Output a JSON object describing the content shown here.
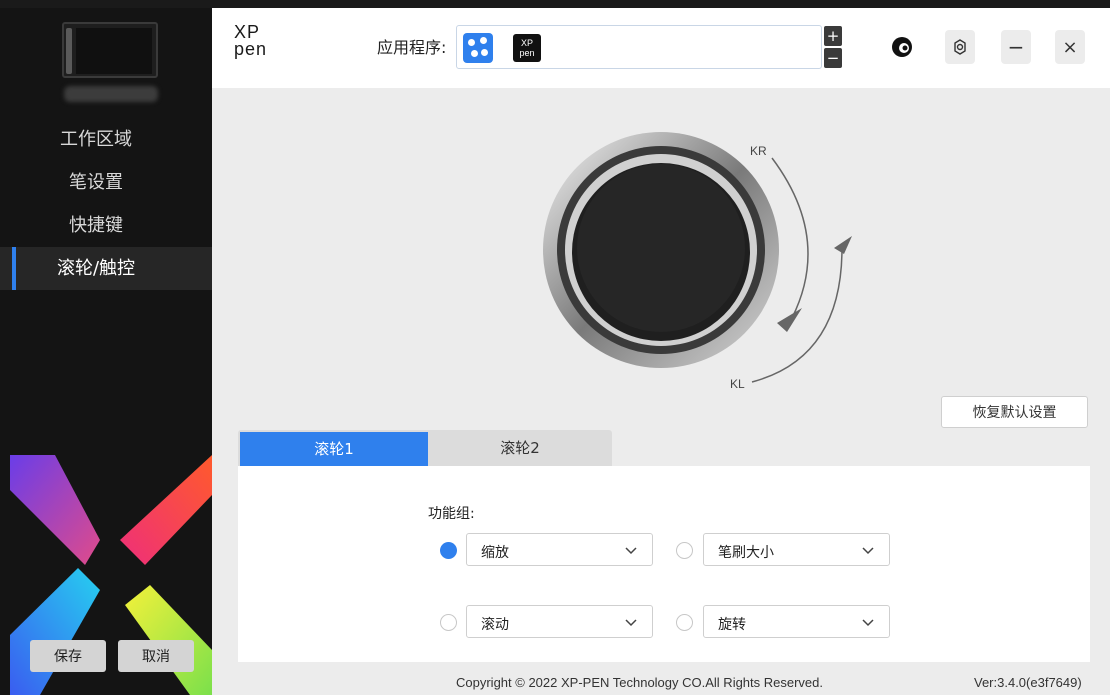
{
  "sidebar": {
    "nav_items": [
      {
        "label": "工作区域"
      },
      {
        "label": "笔设置"
      },
      {
        "label": "快捷键"
      },
      {
        "label": "滚轮/触控"
      }
    ],
    "active_index": 3,
    "save_label": "保存",
    "cancel_label": "取消"
  },
  "header": {
    "logo_line1": "XP",
    "logo_line2": "pen",
    "app_label": "应用程序:",
    "apps": [
      {
        "icon": "all-apps-icon"
      },
      {
        "icon": "xppen-app-icon",
        "text_top": "XP",
        "text_bottom": "pen"
      }
    ],
    "add_symbol": "+",
    "remove_symbol": "−",
    "minimize_symbol": "−",
    "close_symbol": "×"
  },
  "wheel": {
    "label_kr": "KR",
    "label_kl": "KL",
    "reset_label": "恢复默认设置"
  },
  "tabs": [
    {
      "label": "滚轮1"
    },
    {
      "label": "滚轮2"
    }
  ],
  "active_tab": 0,
  "functions": {
    "group_label": "功能组:",
    "options": [
      {
        "label": "缩放",
        "selected": true
      },
      {
        "label": "笔刷大小",
        "selected": false
      },
      {
        "label": "滚动",
        "selected": false
      },
      {
        "label": "旋转",
        "selected": false
      }
    ]
  },
  "footer": {
    "copyright": "Copyright © 2022  XP-PEN Technology CO.All Rights Reserved.",
    "version": "Ver:3.4.0(e3f7649)"
  },
  "colors": {
    "accent": "#2f80ed",
    "sidebar_bg": "#141414"
  }
}
